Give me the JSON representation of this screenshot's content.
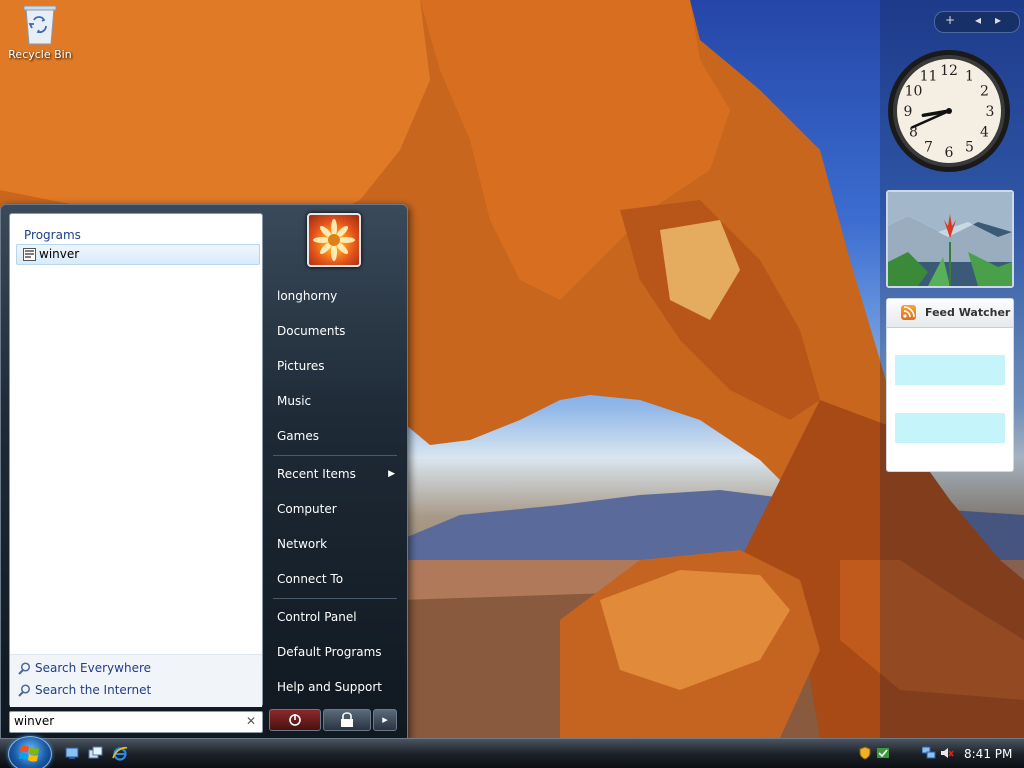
{
  "desktop": {
    "icons": [
      {
        "label": "Recycle Bin",
        "icon": "recycle-bin-icon"
      }
    ]
  },
  "start_menu": {
    "programs_header": "Programs",
    "results": [
      {
        "label": "winver",
        "icon": "program-icon"
      }
    ],
    "search_links": [
      {
        "label": "Search Everywhere",
        "icon": "search-icon"
      },
      {
        "label": "Search the Internet",
        "icon": "search-icon"
      }
    ],
    "search_value": "winver",
    "clear_glyph": "✕",
    "right_items": [
      {
        "label": "longhorny"
      },
      {
        "label": "Documents"
      },
      {
        "label": "Pictures"
      },
      {
        "label": "Music"
      },
      {
        "label": "Games"
      },
      {
        "label": "Recent Items",
        "submenu_glyph": "▶"
      },
      {
        "label": "Computer"
      },
      {
        "label": "Network"
      },
      {
        "label": "Connect To"
      },
      {
        "label": "Control Panel"
      },
      {
        "label": "Default Programs"
      },
      {
        "label": "Help and Support"
      }
    ],
    "power_buttons": [
      {
        "name": "power-icon"
      },
      {
        "name": "lock-icon"
      },
      {
        "name": "arrow-right-icon",
        "glyph": "▸"
      }
    ]
  },
  "sidebar": {
    "controls": {
      "add": "+",
      "prev": "◂",
      "next": "▸"
    },
    "clock": {
      "hour": 8,
      "minute": 41,
      "numerals": [
        "12",
        "1",
        "2",
        "3",
        "4",
        "5",
        "6",
        "7",
        "8",
        "9",
        "10",
        "11"
      ]
    },
    "feed_watcher": {
      "title": "Feed Watcher"
    }
  },
  "taskbar": {
    "quick_launch": [
      "show-desktop-icon",
      "switch-windows-icon",
      "internet-explorer-icon"
    ],
    "tray_icons": [
      "security-shield-icon",
      "network-icon",
      "volume-muted-icon"
    ],
    "time": "8:41 PM"
  },
  "colors": {
    "start_menu_bg": "#1e2a36",
    "link_blue": "#1e3f8a",
    "feed_highlight": "#c6f4fb"
  }
}
